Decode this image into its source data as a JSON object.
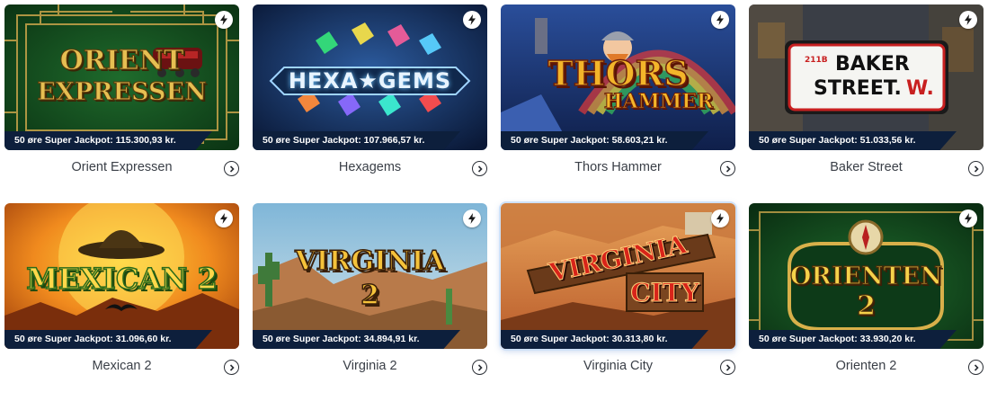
{
  "games": [
    {
      "title": "Orient Expressen",
      "jackpot": "50 øre Super Jackpot: 115.300,93 kr.",
      "logo_lines": [
        "ORIENT",
        "EXPRESSEN"
      ]
    },
    {
      "title": "Hexagems",
      "jackpot": "50 øre Super Jackpot: 107.966,57 kr.",
      "logo_lines": [
        "HEXA★GEMS"
      ]
    },
    {
      "title": "Thors Hammer",
      "jackpot": "50 øre Super Jackpot: 58.603,21 kr.",
      "logo_lines": [
        "THORS",
        "HAMMER"
      ]
    },
    {
      "title": "Baker Street",
      "jackpot": "50 øre Super Jackpot: 51.033,56 kr.",
      "logo_lines": [
        "211B",
        "BAKER",
        "STREET.",
        "W."
      ]
    },
    {
      "title": "Mexican 2",
      "jackpot": "50 øre Super Jackpot: 31.096,60 kr.",
      "logo_lines": [
        "MEXICAN 2"
      ]
    },
    {
      "title": "Virginia 2",
      "jackpot": "50 øre Super Jackpot: 34.894,91 kr.",
      "logo_lines": [
        "VIRGINIA",
        "2"
      ]
    },
    {
      "title": "Virginia City",
      "jackpot": "50 øre Super Jackpot: 30.313,80 kr.",
      "logo_lines": [
        "VIRGINIA",
        "CITY"
      ]
    },
    {
      "title": "Orienten 2",
      "jackpot": "50 øre Super Jackpot: 33.930,20 kr.",
      "logo_lines": [
        "ORIENTEN",
        "2"
      ]
    }
  ],
  "icons": {
    "badge": "lightning-bolt-icon",
    "play": "chevron-right-circle-icon"
  },
  "colors": {
    "jackpot_bar": "#0d1f3c",
    "badge_bg": "#ffffff",
    "title_text": "#3a3f47"
  }
}
